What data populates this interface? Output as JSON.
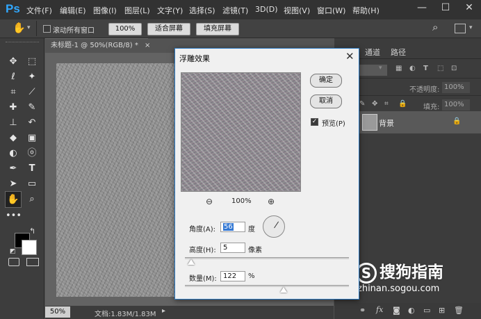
{
  "app": {
    "logo": "Ps"
  },
  "menu": [
    "文件(F)",
    "编辑(E)",
    "图像(I)",
    "图层(L)",
    "文字(Y)",
    "选择(S)",
    "滤镜(T)",
    "3D(D)",
    "视图(V)",
    "窗口(W)",
    "帮助(H)"
  ],
  "window_controls": {
    "minimize": "—",
    "maximize": "☐",
    "close": "✕"
  },
  "options": {
    "scroll_all_label": "滚动所有窗口",
    "zoom_100": "100%",
    "fit_screen": "适合屏幕",
    "fill_screen": "填充屏幕"
  },
  "document": {
    "tab_title": "未标题-1 @ 50%(RGB/8) *",
    "tab_close": "×"
  },
  "status": {
    "zoom": "50%",
    "doc_info": "文档:1.83M/1.83M"
  },
  "panel": {
    "tabs": [
      "通道",
      "路径"
    ],
    "opacity_label": "不透明度:",
    "opacity_value": "100%",
    "fill_label": "填充:",
    "fill_value": "100%",
    "layer_name": "背景"
  },
  "dialog": {
    "title": "浮雕效果",
    "close": "✕",
    "ok": "确定",
    "cancel": "取消",
    "preview_label": "预览(P)",
    "preview_checked": true,
    "zoom_out": "⊖",
    "zoom_in": "⊕",
    "zoom_level": "100%",
    "angle_label": "角度(A):",
    "angle_value": "56",
    "angle_unit": "度",
    "height_label": "高度(H):",
    "height_value": "5",
    "height_unit": "像素",
    "amount_label": "数量(M):",
    "amount_value": "122",
    "amount_unit": "%"
  },
  "watermark": {
    "text": "搜狗指南",
    "url": "zhinan.sogou.com"
  },
  "icons": [
    "hand-icon",
    "move-icon",
    "marquee-icon",
    "lasso-icon",
    "magic-wand-icon",
    "crop-icon",
    "eyedropper-icon",
    "healing-icon",
    "brush-icon",
    "stamp-icon",
    "history-brush-icon",
    "eraser-icon",
    "gradient-icon",
    "blur-icon",
    "dodge-icon",
    "pen-icon",
    "type-icon",
    "path-select-icon",
    "rectangle-icon",
    "zoom-icon",
    "search-icon",
    "lock-icon",
    "fx-icon",
    "trash-icon"
  ]
}
